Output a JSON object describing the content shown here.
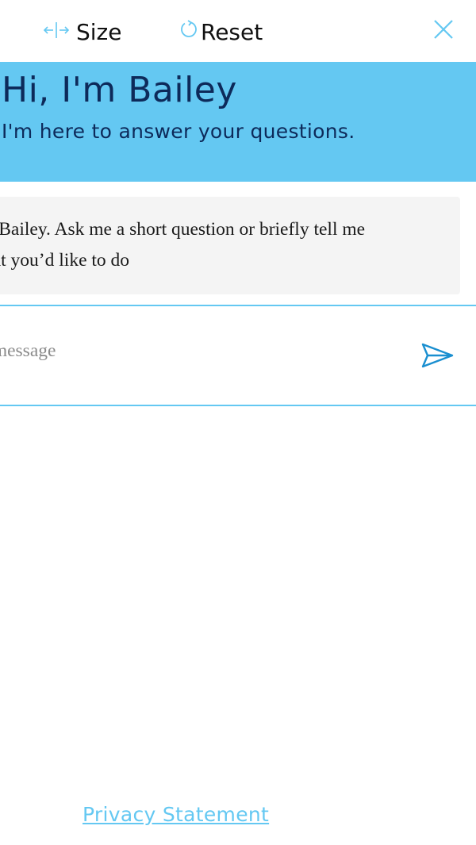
{
  "toolbar": {
    "size_label": "Size",
    "size_icon": "resize-horizontal-icon",
    "reset_label": "Reset",
    "reset_icon": "refresh-icon",
    "close_icon": "close-icon"
  },
  "banner": {
    "title": "Hi, I'm Bailey",
    "subtitle": "I'm here to answer your questions."
  },
  "messages": [
    {
      "sender": "bot",
      "text": "I'm Bailey. Ask me a short question or briefly tell me\nwhat you’d like to do"
    }
  ],
  "composer": {
    "placeholder": "Type a message",
    "value": "",
    "send_icon": "send-icon"
  },
  "footer": {
    "privacy_link": "Privacy Statement"
  },
  "colors": {
    "accent": "#64c8f2",
    "banner_text": "#0d2a5a",
    "icon_blue": "#1a8fd0",
    "bubble_bg": "#f4f4f4"
  }
}
